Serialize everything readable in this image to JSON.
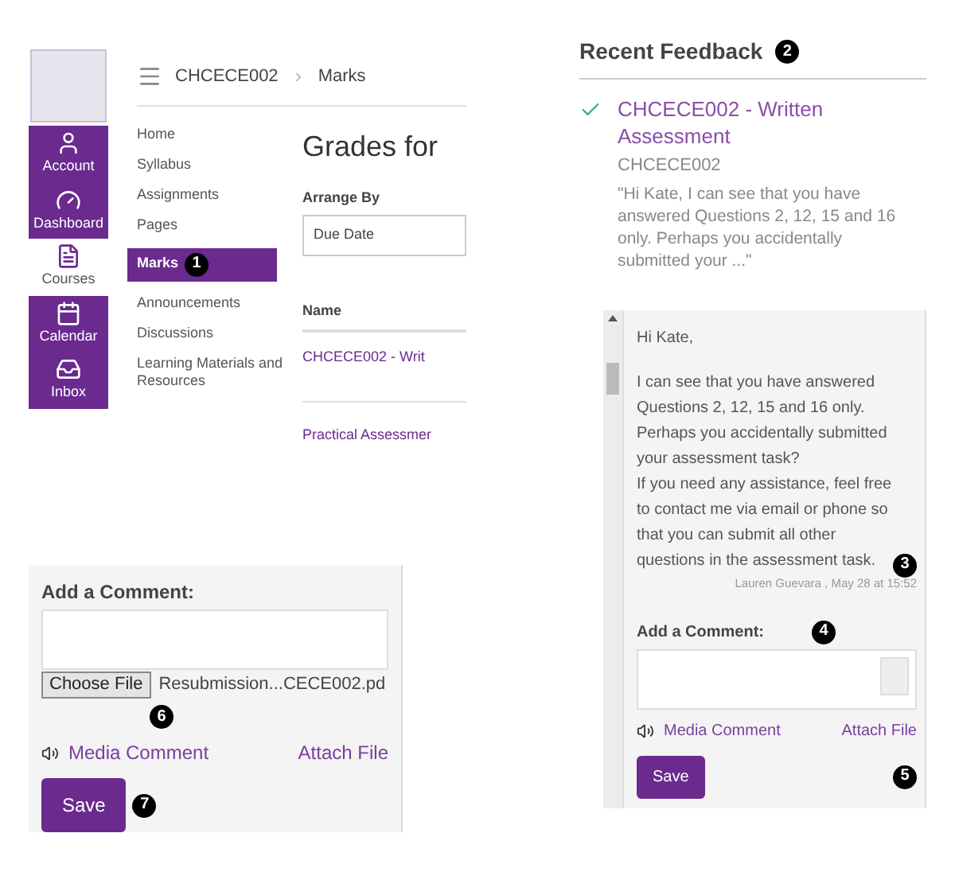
{
  "course_page": {
    "breadcrumb": [
      "CHCECE002",
      "Marks"
    ],
    "global_nav": [
      {
        "label": "Account",
        "kind": "account",
        "selected": false
      },
      {
        "label": "Dashboard",
        "kind": "dashboard",
        "selected": false
      },
      {
        "label": "Courses",
        "kind": "courses",
        "selected": true
      },
      {
        "label": "Calendar",
        "kind": "calendar",
        "selected": false
      },
      {
        "label": "Inbox",
        "kind": "inbox",
        "selected": false
      }
    ],
    "course_menu": [
      {
        "label": "Home",
        "selected": false
      },
      {
        "label": "Syllabus",
        "selected": false
      },
      {
        "label": "Assignments",
        "selected": false
      },
      {
        "label": "Pages",
        "selected": false
      },
      {
        "label": "Marks",
        "selected": true,
        "callout": "1"
      },
      {
        "label": "Announcements",
        "selected": false
      },
      {
        "label": "Discussions",
        "selected": false
      },
      {
        "label": "Learning Materials and Resources",
        "selected": false
      }
    ],
    "heading": "Grades for",
    "arrange_by": {
      "label": "Arrange By",
      "value": "Due Date"
    },
    "table": {
      "columns": [
        "Name"
      ],
      "rows": [
        "CHCECE002 - Writ",
        "Practical Assessmer"
      ]
    }
  },
  "recent_feedback": {
    "title": "Recent Feedback",
    "callout": "2",
    "items": [
      {
        "title": "CHCECE002 - Written Assessment",
        "course": "CHCECE002",
        "excerpt": "\"Hi Kate, I can see that you have answered Questions 2, 12, 15 and 16 only. Perhaps you accidentally submitted your ...\""
      }
    ]
  },
  "comment_thread": {
    "message": [
      "Hi Kate,",
      "I can see that you have answered Questions 2, 12, 15 and 16 only. Perhaps you accidentally submitted your assessment task?",
      "If you need any assistance, feel free to contact me via email or phone so that you can submit all other questions in the assessment task."
    ],
    "message_callout": "3",
    "signature": "Lauren Guevara , May 28 at 15:52",
    "add_comment_label": "Add a Comment:",
    "field_callout": "4",
    "media_comment": "Media Comment",
    "attach_file": "Attach File",
    "attach_callout": "5",
    "save": "Save"
  },
  "comment_form": {
    "add_comment_label": "Add a Comment:",
    "choose_file": "Choose File",
    "file_name": "Resubmission...CECE002.pd",
    "file_callout": "6",
    "media_comment": "Media Comment",
    "attach_file": "Attach File",
    "save": "Save",
    "save_callout": "7"
  }
}
